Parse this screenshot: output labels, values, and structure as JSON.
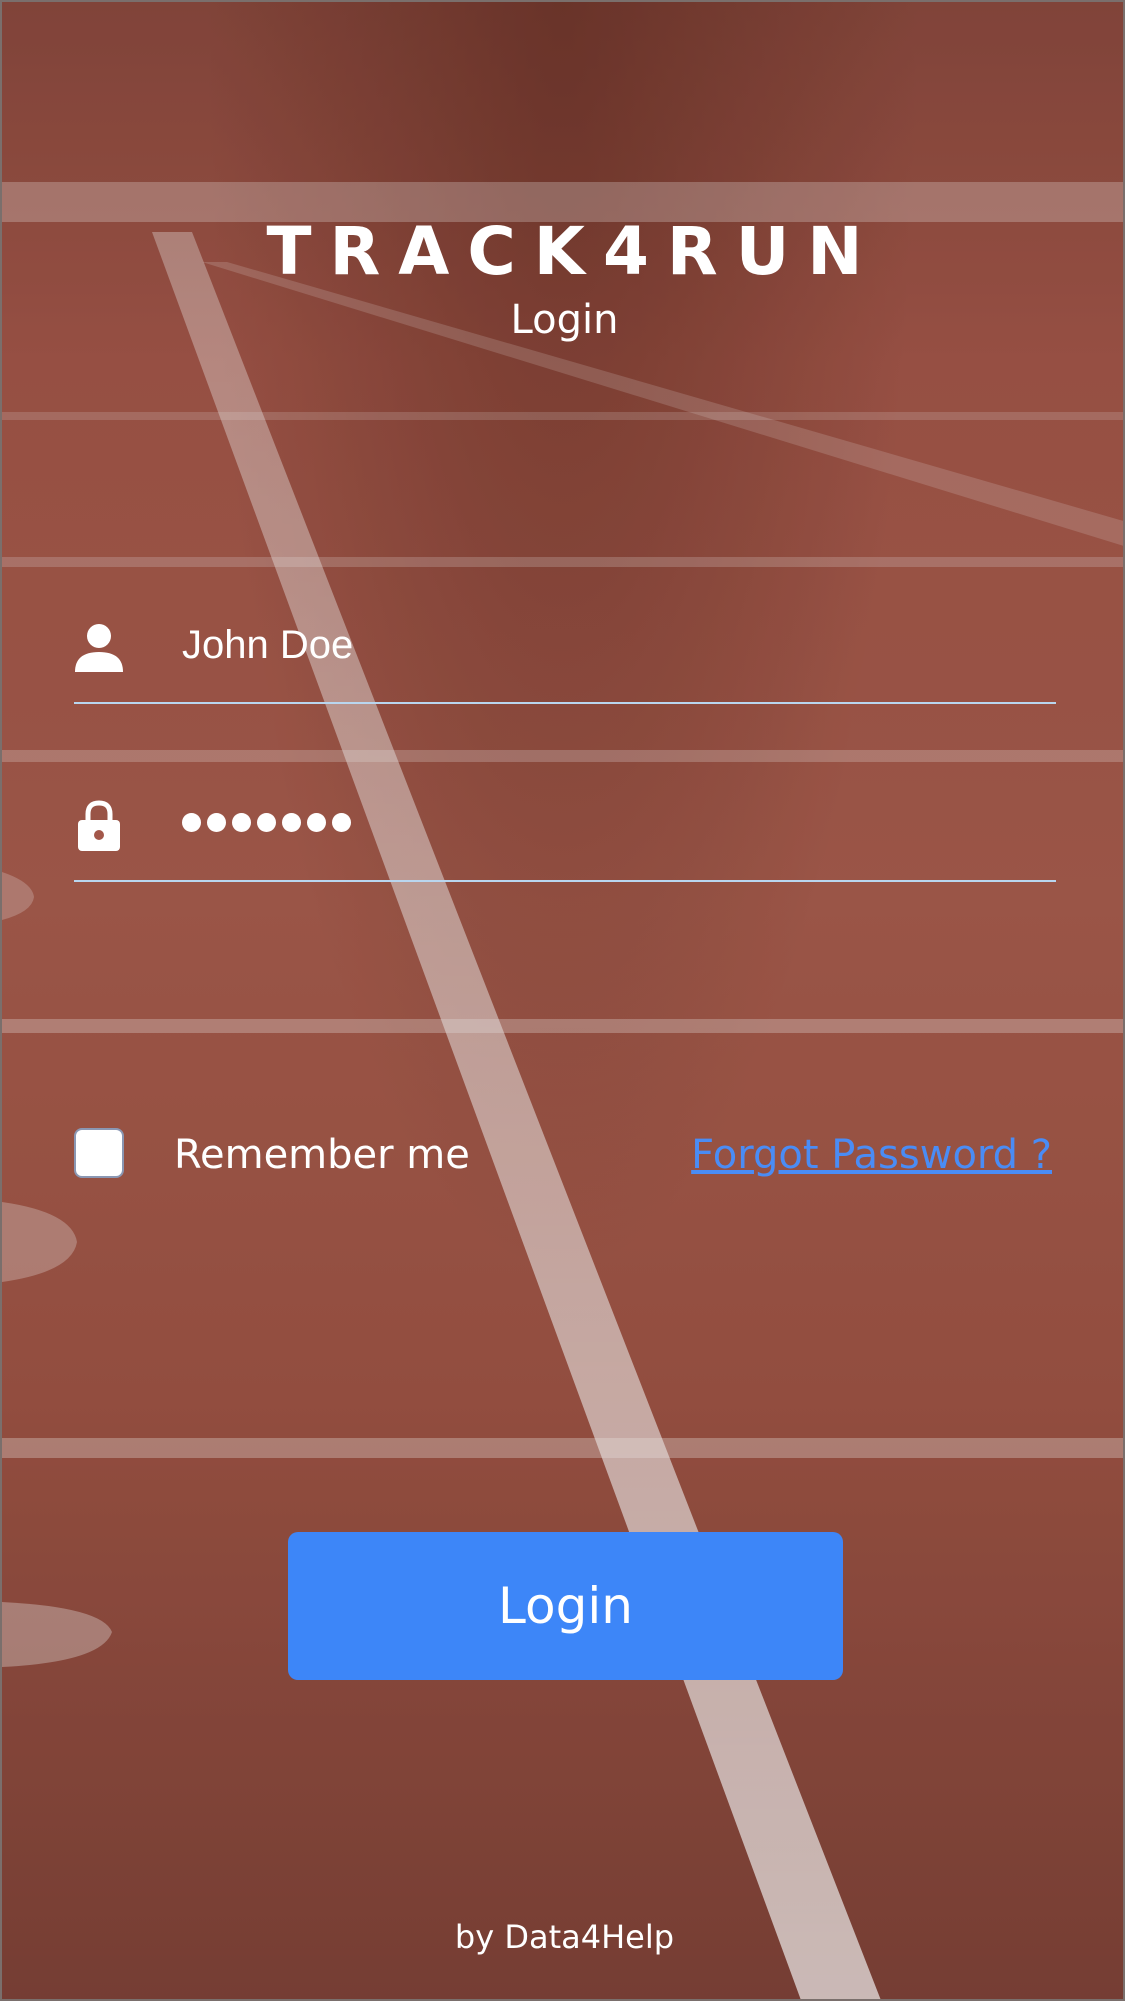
{
  "header": {
    "brand": "TRACK4RUN",
    "subtitle": "Login"
  },
  "form": {
    "username": {
      "icon": "user-icon",
      "value": "John Doe"
    },
    "password": {
      "icon": "lock-icon",
      "masked_length": 7
    },
    "remember_me": {
      "label": "Remember me",
      "checked": false
    },
    "forgot_password_label": "Forgot Password ?",
    "submit_label": "Login"
  },
  "footer": {
    "text": "by Data4Help"
  },
  "colors": {
    "accent": "#3d86f8",
    "link": "#4a8cf5",
    "field_underline": "#b9d6ef",
    "background": "#a3574a"
  }
}
